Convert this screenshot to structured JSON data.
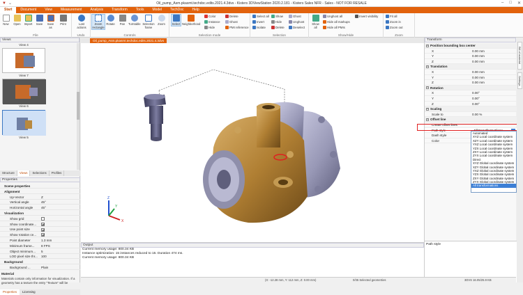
{
  "window": {
    "title": "Oil_pump_Asm.pkasmt.techdoc.edits.2021.4.3dvs - Kisters 3DViewStation 2020.2.181 - Kisters Sales NFR - Sales - NOT FOR RESALE",
    "minimize": "–",
    "maximize": "□",
    "close": "✕"
  },
  "tabs": [
    "Start",
    "Document",
    "View",
    "Measurement",
    "Analysis",
    "Transform",
    "Tools",
    "Model",
    "TechDoc",
    "Help"
  ],
  "ribbon": {
    "file": {
      "label": "File",
      "buttons": [
        "New",
        "Open",
        "Import",
        "Save",
        "Save as",
        "Print"
      ]
    },
    "undo": {
      "label": "Undo",
      "buttons": [
        "Last actions"
      ]
    },
    "controls": {
      "label": "Controls",
      "buttons": [
        "Zoom rectangle",
        "Rotate",
        "Pan",
        "Turntable",
        "Selection frame",
        "Zoom"
      ]
    },
    "selection_mode": {
      "label": "Selection mode",
      "buttons": [
        "Select",
        "Neighborhood"
      ],
      "small": [
        "Color",
        "Instance",
        "Hide",
        "Delete",
        "Ghost",
        "PMI reference"
      ]
    },
    "selection": {
      "label": "Selection",
      "small": [
        "Select all",
        "Invert",
        "Isolate",
        "Show",
        "Hide",
        "Delete",
        "Ghost",
        "Unghost",
        "Deselect"
      ]
    },
    "show_hide": {
      "label": "Show/Hide",
      "buttons": [
        "Show all"
      ],
      "small": [
        "Unghost all",
        "Hide all markups",
        "Hide all PMIs",
        "Invert visibility"
      ]
    },
    "zoom": {
      "label": "Zoom",
      "small": [
        "Fit all",
        "Zoom in",
        "Zoom out"
      ]
    }
  },
  "views_panel": {
    "title": "Views",
    "items": [
      {
        "label": "View 4"
      },
      {
        "label": "View 7"
      },
      {
        "label": "View 6"
      },
      {
        "label": "View 5"
      }
    ],
    "tabs": [
      "Structure",
      "Views",
      "Selections",
      "Profiles"
    ]
  },
  "properties_panel": {
    "title": "Properties",
    "rows": [
      {
        "k": "Scene properties",
        "v": "",
        "type": "section"
      },
      {
        "k": "Alignment",
        "v": "",
        "type": "section"
      },
      {
        "k": "Up-Vector",
        "v": "Z"
      },
      {
        "k": "Vertical angle",
        "v": "45°"
      },
      {
        "k": "Horizontal angle",
        "v": "45°"
      },
      {
        "k": "Visualization",
        "v": "",
        "type": "section"
      },
      {
        "k": "Show grid",
        "v": "",
        "cb": false
      },
      {
        "k": "Show coordinate...",
        "v": "",
        "cb": true
      },
      {
        "k": "Use point size",
        "v": "",
        "cb": true
      },
      {
        "k": "Show rotation ce...",
        "v": "",
        "cb": true
      },
      {
        "k": "Point diameter",
        "v": "1.3 mm"
      },
      {
        "k": "Minimum frame...",
        "v": "8 FPS"
      },
      {
        "k": "Object minimum...",
        "v": "5"
      },
      {
        "k": "LOD pixel size thr...",
        "v": "100"
      },
      {
        "k": "Background",
        "v": "",
        "type": "section"
      },
      {
        "k": "Background ...",
        "v": "Plain"
      }
    ],
    "info_title": "Material",
    "info_text": "Materials contain only information for visualization. If a geometry has a texture the entry \"Texture\" will be",
    "tabs": [
      "Properties",
      "Licensing"
    ]
  },
  "document": {
    "tab": "Oil_pump_Asm.pkasmt.techdoc.edits.2021.4.3dvs"
  },
  "output": {
    "title": "Output",
    "lines": [
      "Current memory usage: 800.34 KB",
      "Instance optimization: 15 instances reduced to 15. Duration 474 ms.",
      "Current memory usage: 800.34 KB"
    ],
    "tabs": [
      "Progress",
      "Information",
      "General"
    ]
  },
  "transform_panel": {
    "title": "Transform",
    "rows": [
      {
        "k": "Position bounding box center",
        "v": "",
        "type": "hdr"
      },
      {
        "k": "X",
        "v": "0.00 mm"
      },
      {
        "k": "Y",
        "v": "0.00 mm"
      },
      {
        "k": "Z",
        "v": "0.00 mm"
      },
      {
        "k": "Translation",
        "v": "",
        "type": "hdr"
      },
      {
        "k": "X",
        "v": "0.00 mm"
      },
      {
        "k": "Y",
        "v": "0.00 mm"
      },
      {
        "k": "Z",
        "v": "0.00 mm"
      },
      {
        "k": "Rotation",
        "v": "",
        "type": "hdr"
      },
      {
        "k": "X",
        "v": "0.00°"
      },
      {
        "k": "Y",
        "v": "0.00°"
      },
      {
        "k": "Z",
        "v": "0.00°"
      },
      {
        "k": "Scaling",
        "v": "",
        "type": "hdr"
      },
      {
        "k": "Scale to",
        "v": "0.00 %"
      },
      {
        "k": "Offset line",
        "v": "",
        "type": "hdr"
      },
      {
        "k": "Create offset lines",
        "v": ""
      },
      {
        "k": "Path style",
        "v": "All transformations"
      },
      {
        "k": "Dash style",
        "v": ""
      },
      {
        "k": "Color",
        "v": ""
      }
    ],
    "help_title": "Path style"
  },
  "path_style_options": [
    "Automated",
    "XYZ Local coordinate system",
    "XZY Local coordinate system",
    "YXZ Local coordinate system",
    "YZX Local coordinate system",
    "ZXY Local coordinate system",
    "ZYX Local coordinate system",
    "Direct",
    "XYZ Global coordinate system",
    "XZY Global coordinate system",
    "YXZ Global coordinate system",
    "YZX Global coordinate system",
    "ZXY Global coordinate system",
    "ZYX Global coordinate system",
    "All transformations"
  ],
  "path_style_selected": "All transformations",
  "right_side_tabs": [
    "Bill of material",
    "Settings"
  ],
  "status": {
    "coords": "(X: -12.28 mm, Y: 112 mm, Z: 0.00 mm)",
    "selection": "0/35 Selected geometries",
    "memory": "3DVS 16.05/25.9 KB"
  },
  "axis_labels": {
    "x": "X",
    "y": "Y",
    "z": "Z"
  },
  "colors": {
    "accent": "#e2620c",
    "part_bronze": "#b8893e",
    "part_grey": "#9a9ab4"
  }
}
